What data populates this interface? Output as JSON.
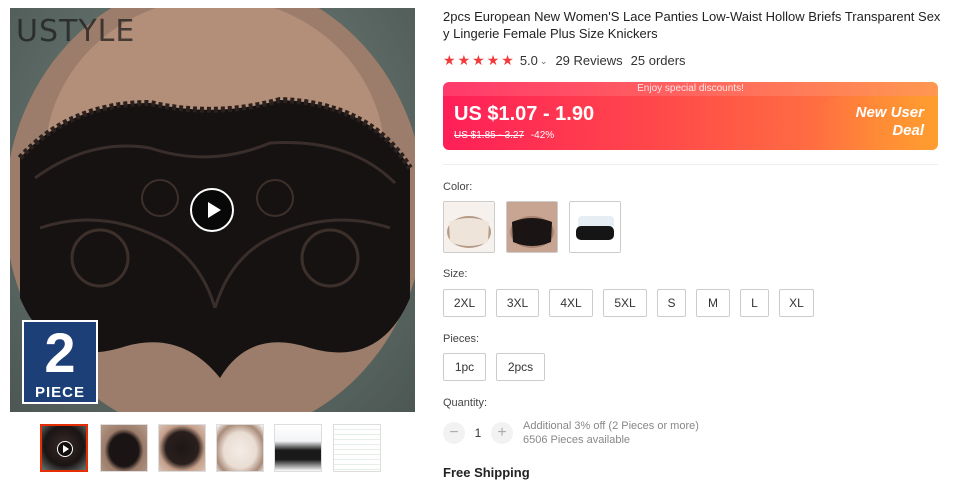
{
  "product": {
    "title": "2pcs European New Women'S Lace Panties Low-Waist Hollow Briefs Transparent Sexy Lingerie Female Plus Size Knickers",
    "image_watermark": "USTYLE",
    "piece_badge": {
      "number": "2",
      "label": "PIECE"
    }
  },
  "rating": {
    "stars": 5,
    "score": "5.0",
    "reviews": "29 Reviews",
    "orders": "25 orders"
  },
  "price": {
    "promo_banner": "Enjoy special discounts!",
    "current": "US $1.07 - 1.90",
    "original": "US $1.85 - 3.27",
    "discount": "-42%",
    "deal_label_line1": "New User",
    "deal_label_line2": "Deal"
  },
  "options": {
    "color_label": "Color:",
    "size_label": "Size:",
    "sizes": [
      "2XL",
      "3XL",
      "4XL",
      "5XL",
      "S",
      "M",
      "L",
      "XL"
    ],
    "pieces_label": "Pieces:",
    "pieces": [
      "1pc",
      "2pcs"
    ]
  },
  "quantity": {
    "label": "Quantity:",
    "minus": "−",
    "value": "1",
    "plus": "+",
    "additional": "Additional 3% off (2 Pieces or more)",
    "available": "6506 Pieces available"
  },
  "shipping": {
    "title": "Free Shipping"
  },
  "colors": {
    "accent": "#e62e04",
    "star": "#f33a3a",
    "price_gradient_start": "#ff1f58",
    "price_gradient_end": "#ff8a3a",
    "badge": "#1d3f78"
  },
  "icons": {
    "play": "play-icon",
    "star": "star-icon",
    "caret": "chevron-down-icon"
  }
}
